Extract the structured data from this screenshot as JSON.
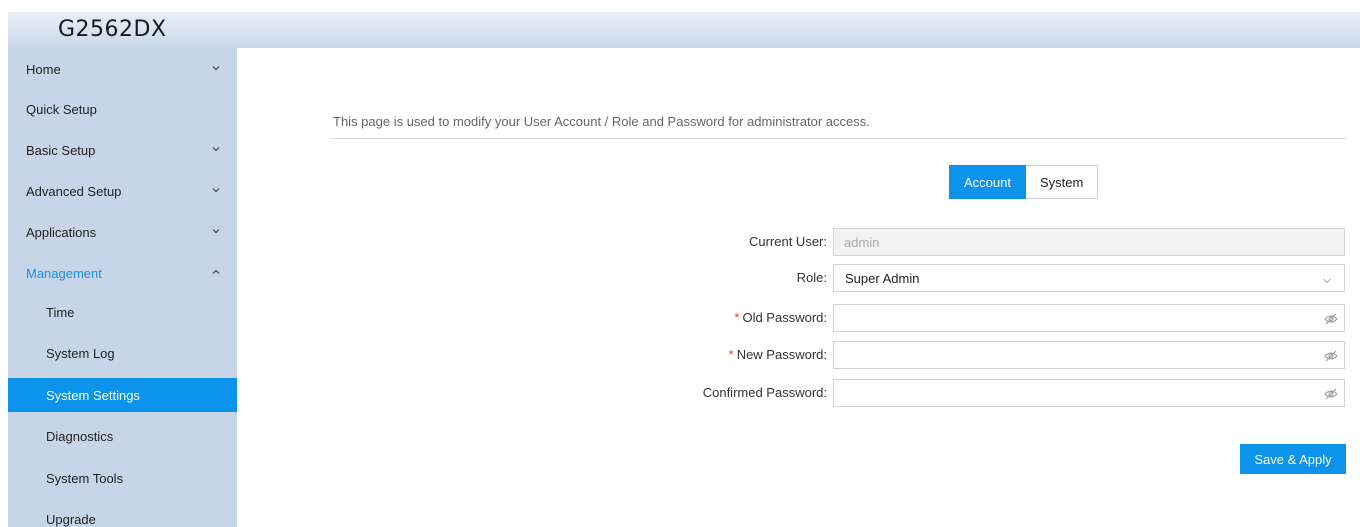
{
  "header": {
    "brand": "G2562DX"
  },
  "sidebar": {
    "items": [
      {
        "label": "Home",
        "chevron": "down"
      },
      {
        "label": "Quick Setup"
      },
      {
        "label": "Basic Setup",
        "chevron": "down"
      },
      {
        "label": "Advanced Setup",
        "chevron": "down"
      },
      {
        "label": "Applications",
        "chevron": "down"
      },
      {
        "label": "Management",
        "chevron": "up",
        "state": "open"
      },
      {
        "label": "Time"
      },
      {
        "label": "System Log"
      },
      {
        "label": "System Settings",
        "state": "active"
      },
      {
        "label": "Diagnostics"
      },
      {
        "label": "System Tools"
      },
      {
        "label": "Upgrade"
      }
    ]
  },
  "main": {
    "description": "This page is used to modify your User Account / Role and Password for administrator access.",
    "tabs": [
      {
        "label": "Account",
        "active": true
      },
      {
        "label": "System",
        "active": false
      }
    ],
    "form": {
      "current_user": {
        "label": "Current User:",
        "value": "admin"
      },
      "role": {
        "label": "Role:",
        "value": "Super Admin"
      },
      "old_password": {
        "label": "Old Password:",
        "required": "*"
      },
      "new_password": {
        "label": "New Password:",
        "required": "*"
      },
      "confirmed_password": {
        "label": "Confirmed Password:"
      }
    },
    "save_label": "Save & Apply"
  },
  "colors": {
    "accent": "#0c93ec",
    "sidebar_bg": "#c6d6e8",
    "required": "#e5392f"
  },
  "icons": {
    "chevron": "chevron-icon",
    "visibility": "eye-slash-icon",
    "dropdown": "chevron-down-icon"
  }
}
